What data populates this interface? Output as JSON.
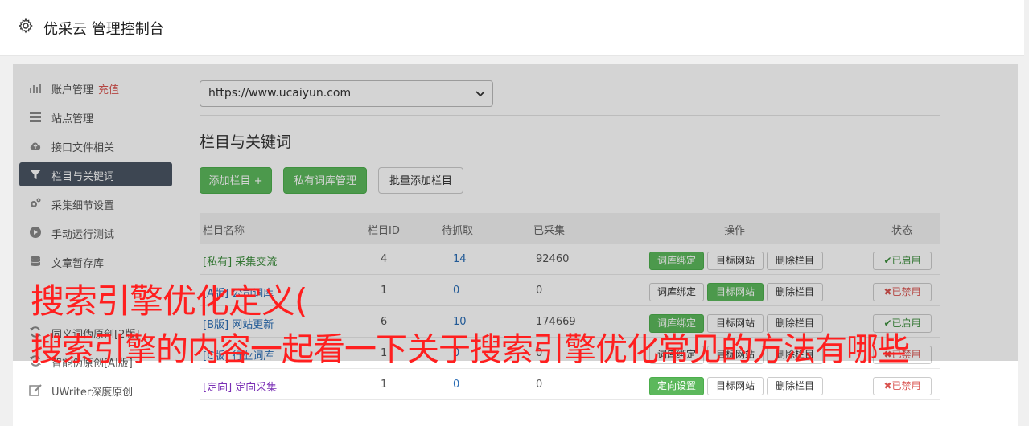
{
  "header": {
    "title": "优采云 管理控制台",
    "icon": "gear-icon"
  },
  "sidebar": {
    "items": [
      {
        "label": "账户管理",
        "extra": "充值",
        "icon": "bar-chart-icon",
        "active": false
      },
      {
        "label": "站点管理",
        "icon": "server-icon",
        "active": false
      },
      {
        "label": "接口文件相关",
        "icon": "cloud-upload-icon",
        "active": false
      },
      {
        "label": "栏目与关键词",
        "icon": "filter-icon",
        "active": true
      },
      {
        "label": "采集细节设置",
        "icon": "gears-icon",
        "active": false
      },
      {
        "label": "手动运行测试",
        "icon": "play-circle-icon",
        "active": false
      },
      {
        "label": "文章暂存库",
        "icon": "database-icon",
        "active": false
      },
      {
        "label": "同义词伪原创[2版]",
        "icon": "refresh-icon",
        "active": false
      },
      {
        "label": "智能伪原创[AI版]",
        "icon": "refresh-icon",
        "active": false
      },
      {
        "label": "UWriter深度原创",
        "icon": "edit-icon",
        "active": false
      }
    ]
  },
  "main": {
    "site_select": {
      "value": "https://www.ucaiyun.com"
    },
    "section_title": "栏目与关键词",
    "buttons": {
      "add_column": "添加栏目 +",
      "private_lexicon": "私有词库管理",
      "batch_add": "批量添加栏目"
    },
    "table": {
      "headers": {
        "name": "栏目名称",
        "id": "栏目ID",
        "pending": "待抓取",
        "collected": "已采集",
        "ops": "操作",
        "status": "状态"
      },
      "rows": [
        {
          "name": "[私有] 采集交流",
          "id": "4",
          "pending": "14",
          "collected": "92460",
          "op1": "词库绑定",
          "op2": "目标网站",
          "op3": "删除栏目",
          "status": "✔已启用",
          "enabled": true
        },
        {
          "name": "[A版] 公司词库",
          "id": "1",
          "pending": "0",
          "collected": "0",
          "op1": "词库绑定",
          "op2": "目标网站",
          "op3": "删除栏目",
          "status": "✖已禁用",
          "enabled": false
        },
        {
          "name": "[B版] 网站更新",
          "id": "6",
          "pending": "10",
          "collected": "174669",
          "op1": "词库绑定",
          "op2": "目标网站",
          "op3": "删除栏目",
          "status": "✔已启用",
          "enabled": true
        },
        {
          "name": "[C版] 行业词库",
          "id": "1",
          "pending": "0",
          "collected": "0",
          "op1": "词库绑定",
          "op2": "目标网站",
          "op3": "删除栏目",
          "status": "✖已禁用",
          "enabled": false
        },
        {
          "name": "[定向] 定向采集",
          "id": "1",
          "pending": "0",
          "collected": "0",
          "op1": "定向设置",
          "op2": "目标网站",
          "op3": "删除栏目",
          "status": "✖已禁用",
          "enabled": false
        }
      ]
    }
  },
  "overlay": {
    "line1": "搜索引擎优化定义(",
    "line2": "搜索引擎的内容一起看一下关于搜索引擎优化常见的方法有哪些"
  }
}
